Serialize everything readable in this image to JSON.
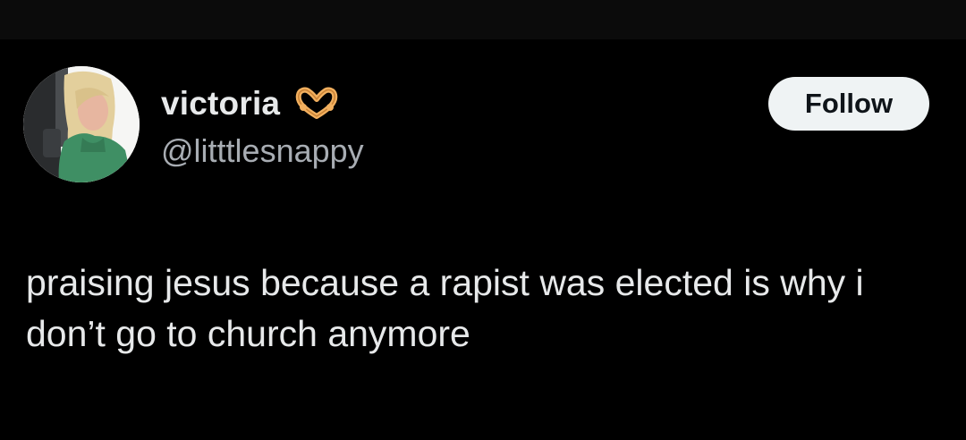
{
  "author": {
    "display_name": "victoria",
    "name_emoji": "heart-hands-icon",
    "handle": "@litttlesnappy",
    "avatar": "profile-photo"
  },
  "actions": {
    "follow_label": "Follow"
  },
  "post": {
    "text": "praising jesus because a rapist was elected is why i don’t go to church anymore"
  },
  "colors": {
    "background": "#000000",
    "text_primary": "#e7e9ea",
    "text_secondary": "#a8adb3",
    "follow_bg": "#eff3f4",
    "follow_text": "#0f1419"
  }
}
